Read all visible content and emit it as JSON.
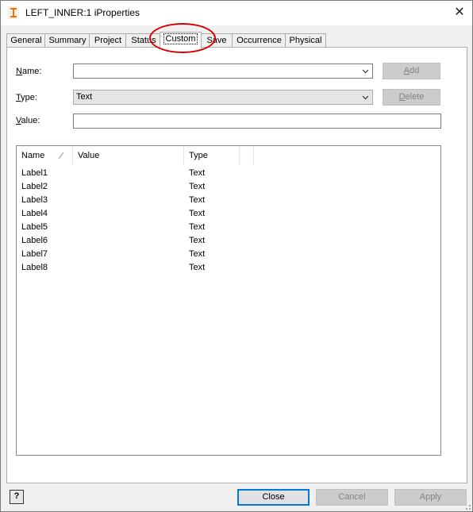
{
  "window": {
    "title": "LEFT_INNER:1 iProperties",
    "close_glyph": "✕",
    "icon": "inventor-app-icon"
  },
  "tabs": [
    {
      "label": "General",
      "active": false
    },
    {
      "label": "Summary",
      "active": false
    },
    {
      "label": "Project",
      "active": false
    },
    {
      "label": "Status",
      "active": false
    },
    {
      "label": "Custom",
      "active": true
    },
    {
      "label": "Save",
      "active": false
    },
    {
      "label": "Occurrence",
      "active": false
    },
    {
      "label": "Physical",
      "active": false
    }
  ],
  "form": {
    "name_label_key": "N",
    "name_label_rest": "ame:",
    "name_value": "",
    "type_label_key": "T",
    "type_label_rest": "ype:",
    "type_value": "Text",
    "value_label_key": "V",
    "value_label_rest": "alue:",
    "value_value": "",
    "add_key": "A",
    "add_rest": "dd",
    "delete_key": "D",
    "delete_rest": "elete"
  },
  "table": {
    "columns": [
      "Name",
      "Value",
      "Type"
    ],
    "rows": [
      {
        "name": "Label1",
        "value": "",
        "type": "Text"
      },
      {
        "name": "Label2",
        "value": "",
        "type": "Text"
      },
      {
        "name": "Label3",
        "value": "",
        "type": "Text"
      },
      {
        "name": "Label4",
        "value": "",
        "type": "Text"
      },
      {
        "name": "Label5",
        "value": "",
        "type": "Text"
      },
      {
        "name": "Label6",
        "value": "",
        "type": "Text"
      },
      {
        "name": "Label7",
        "value": "",
        "type": "Text"
      },
      {
        "name": "Label8",
        "value": "",
        "type": "Text"
      }
    ]
  },
  "footer": {
    "help_label": "?",
    "close_label": "Close",
    "cancel_label": "Cancel",
    "apply_label": "Apply"
  },
  "colors": {
    "focus_border": "#0078d7",
    "annotation_red": "#d40000"
  }
}
